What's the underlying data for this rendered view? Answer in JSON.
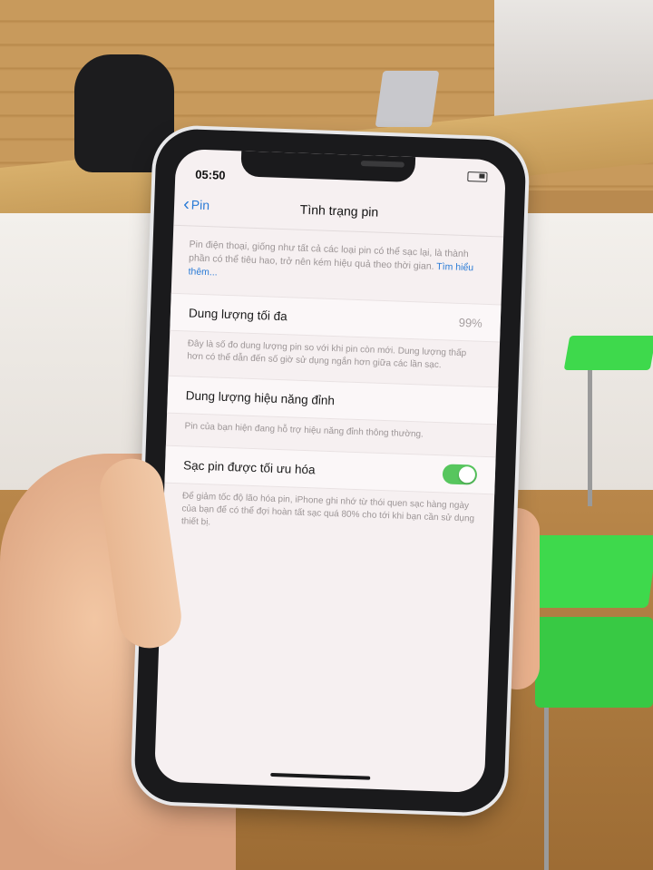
{
  "status_bar": {
    "time": "05:50"
  },
  "nav": {
    "back_label": "Pin",
    "title": "Tình trạng pin"
  },
  "intro": {
    "text": "Pin điện thoại, giống như tất cả các loại pin có thể sạc lại, là thành phần có thể tiêu hao, trở nên kém hiệu quả theo thời gian.",
    "link": "Tìm hiểu thêm..."
  },
  "max_capacity": {
    "label": "Dung lượng tối đa",
    "value": "99%",
    "note": "Đây là số đo dung lượng pin so với khi pin còn mới. Dung lượng thấp hơn có thể dẫn đến số giờ sử dụng ngắn hơn giữa các lần sạc."
  },
  "peak_performance": {
    "label": "Dung lượng hiệu năng đỉnh",
    "note": "Pin của bạn hiện đang hỗ trợ hiệu năng đỉnh thông thường."
  },
  "optimized_charging": {
    "label": "Sạc pin được tối ưu hóa",
    "enabled": true,
    "note": "Để giảm tốc độ lão hóa pin, iPhone ghi nhớ từ thói quen sạc hàng ngày của bạn để có thể đợi hoàn tất sạc quá 80% cho tới khi bạn cần sử dụng thiết bị."
  },
  "colors": {
    "accent": "#2a7bd6",
    "toggle_on": "#57c65e"
  }
}
